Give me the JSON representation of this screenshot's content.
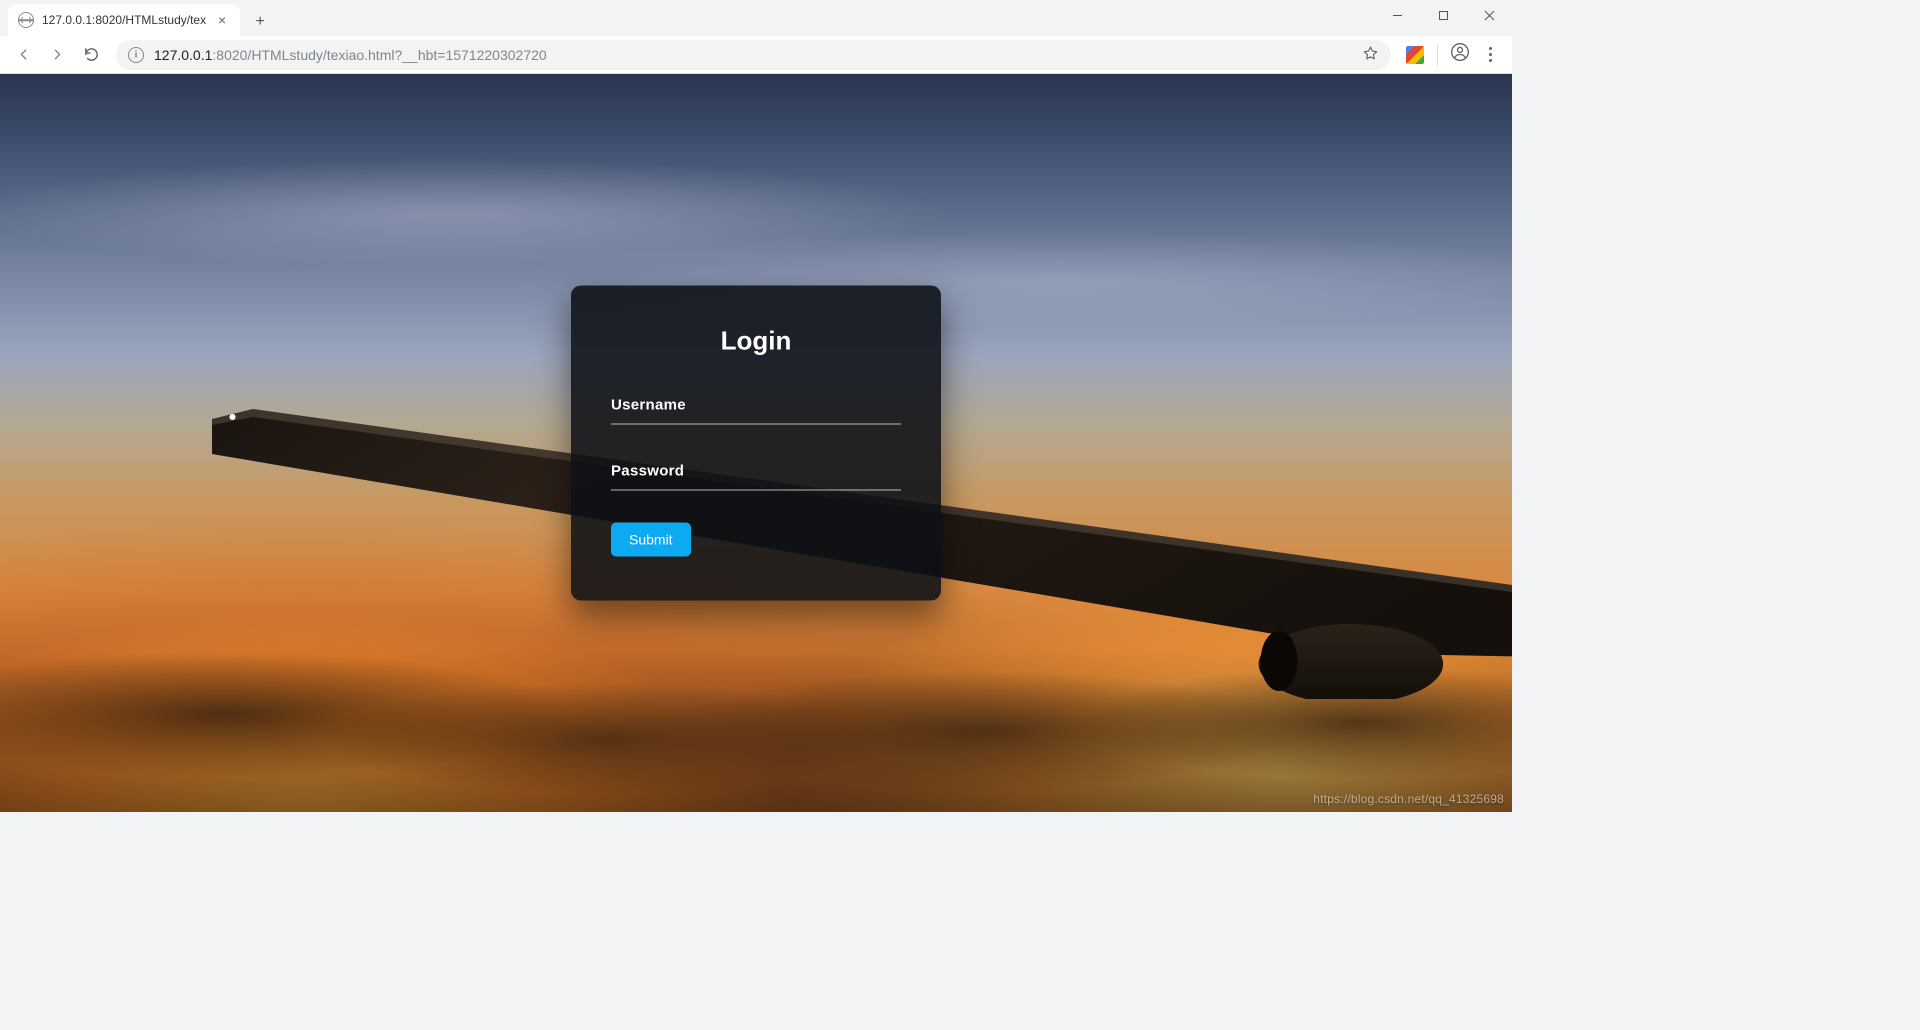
{
  "browser": {
    "tab": {
      "title": "127.0.0.1:8020/HTMLstudy/tex"
    },
    "url": {
      "host": "127.0.0.1",
      "path": ":8020/HTMLstudy/texiao.html?__hbt=1571220302720"
    }
  },
  "login": {
    "title": "Login",
    "username_label": "Username",
    "username_value": "",
    "password_label": "Password",
    "password_value": "",
    "submit_label": "Submit"
  },
  "watermark": "https://blog.csdn.net/qq_41325698",
  "colors": {
    "accent": "#0eaaf1",
    "panel": "rgba(12,16,22,0.88)"
  }
}
